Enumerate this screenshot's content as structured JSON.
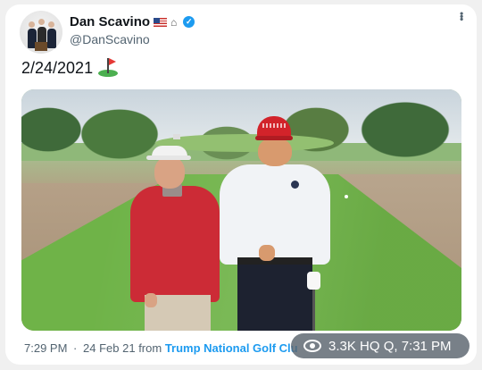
{
  "tweet": {
    "display_name": "Dan Scavino",
    "handle": "@DanScavino",
    "text": "2/24/2021",
    "text_emoji": "flag-in-hole-icon",
    "verified_icon": "verified-badge-icon",
    "name_emoji": [
      "us-flag-icon",
      "house-icon"
    ],
    "accent_color": "#1d9bf0"
  },
  "photo": {
    "icon_names": [
      "golf-course-scene"
    ]
  },
  "meta": {
    "time": "7:29 PM",
    "separator": "·",
    "date": "24 Feb 21",
    "from_label": "from",
    "source": "Trump National Golf Clu"
  },
  "overlay": {
    "icon": "eye-icon",
    "text": "3.3K HQ Q, 7:31 PM"
  }
}
